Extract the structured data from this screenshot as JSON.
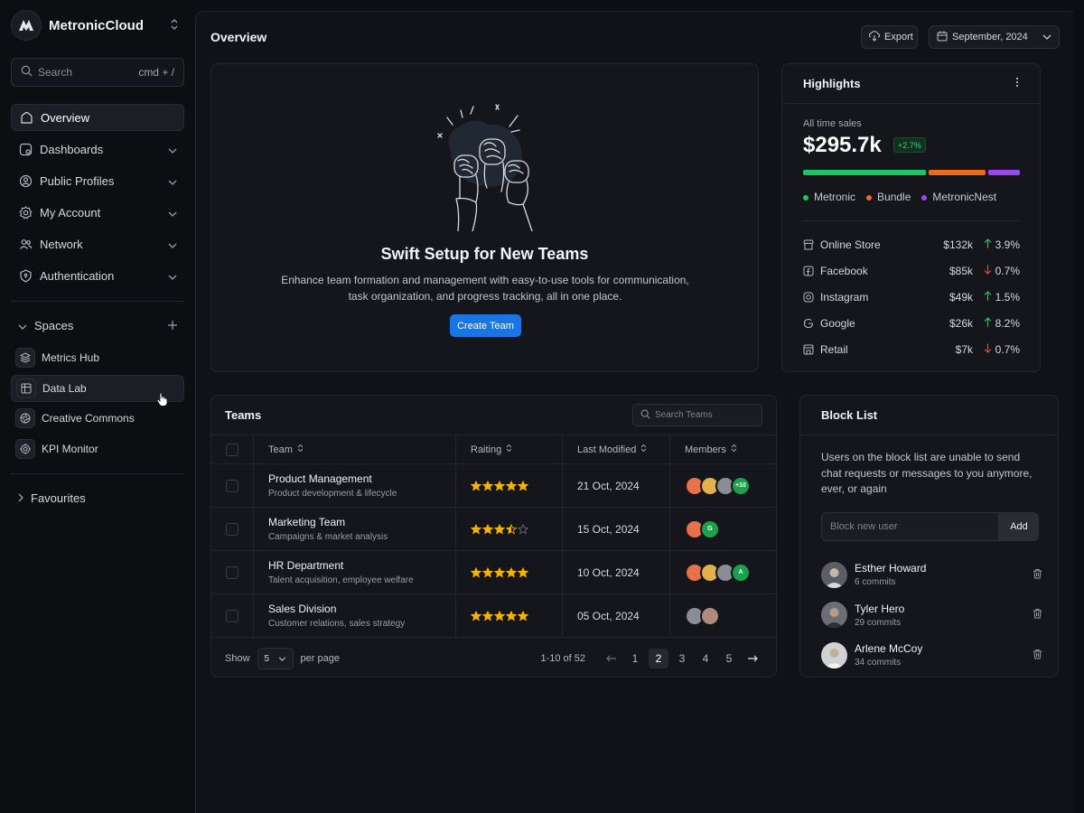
{
  "brand": {
    "name": "MetronicCloud"
  },
  "search": {
    "placeholder": "Search",
    "shortcut": "cmd + /"
  },
  "nav": [
    {
      "label": "Overview",
      "icon": "home-icon"
    },
    {
      "label": "Dashboards",
      "icon": "dashboard-icon"
    },
    {
      "label": "Public Profiles",
      "icon": "profile-icon"
    },
    {
      "label": "My Account",
      "icon": "gear-icon"
    },
    {
      "label": "Network",
      "icon": "users-icon"
    },
    {
      "label": "Authentication",
      "icon": "shield-icon"
    }
  ],
  "spaces": {
    "title": "Spaces",
    "items": [
      {
        "label": "Metrics Hub"
      },
      {
        "label": "Data Lab"
      },
      {
        "label": "Creative Commons"
      },
      {
        "label": "KPI Monitor"
      }
    ]
  },
  "favourites": {
    "title": "Favourites"
  },
  "header": {
    "title": "Overview",
    "export_label": "Export",
    "date_label": "September, 2024"
  },
  "hero": {
    "title": "Swift Setup for New Teams",
    "description": "Enhance team formation and management with easy-to-use tools for communication, task organization, and progress tracking, all in one place.",
    "button_label": "Create Team"
  },
  "highlights": {
    "title": "Highlights",
    "subtitle": "All time sales",
    "value": "$295.7k",
    "badge": "+2.7%",
    "segments": [
      {
        "name": "Metronic",
        "color": "#17c964",
        "share": 0.58
      },
      {
        "name": "Bundle",
        "color": "#f06a1b",
        "share": 0.27
      },
      {
        "name": "MetronicNest",
        "color": "#9b47f5",
        "share": 0.15
      }
    ],
    "rows": [
      {
        "name": "Online Store",
        "amount": "$132k",
        "change": "3.9%",
        "direction": "up"
      },
      {
        "name": "Facebook",
        "amount": "$85k",
        "change": "0.7%",
        "direction": "down"
      },
      {
        "name": "Instagram",
        "amount": "$49k",
        "change": "1.5%",
        "direction": "up"
      },
      {
        "name": "Google",
        "amount": "$26k",
        "change": "8.2%",
        "direction": "up"
      },
      {
        "name": "Retail",
        "amount": "$7k",
        "change": "0.7%",
        "direction": "down"
      }
    ]
  },
  "teams": {
    "title": "Teams",
    "search_placeholder": "Search Teams",
    "columns": {
      "team": "Team",
      "rating": "Raiting",
      "modified": "Last Modified",
      "members": "Members"
    },
    "rows": [
      {
        "name": "Product Management",
        "desc": "Product development & lifecycle",
        "rating": 5,
        "date": "21 Oct, 2024",
        "extra": "+10"
      },
      {
        "name": "Marketing Team",
        "desc": "Campaigns & market analysis",
        "rating": 3.5,
        "date": "15 Oct, 2024",
        "extra": "G"
      },
      {
        "name": "HR Department",
        "desc": "Talent acquisition, employee welfare",
        "rating": 5,
        "date": "10 Oct, 2024",
        "extra": "A"
      },
      {
        "name": "Sales Division",
        "desc": "Customer relations, sales strategy",
        "rating": 5,
        "date": "05 Oct, 2024",
        "extra": ""
      }
    ],
    "footer": {
      "show": "Show",
      "per_page_value": "5",
      "per_page": "per page",
      "range": "1-10 of 52",
      "pages": [
        "1",
        "2",
        "3",
        "4",
        "5"
      ],
      "current_page": "2"
    }
  },
  "blocklist": {
    "title": "Block List",
    "description": "Users on the block list are unable to send chat requests or messages to you anymore, ever, or again",
    "input_placeholder": "Block new user",
    "add_label": "Add",
    "users": [
      {
        "name": "Esther Howard",
        "commits": "6 commits"
      },
      {
        "name": "Tyler Hero",
        "commits": "29 commits"
      },
      {
        "name": "Arlene McCoy",
        "commits": "34 commits"
      }
    ]
  },
  "colors": {
    "accent": "#1b74e4",
    "up": "#17c964",
    "down": "#f04438",
    "star": "#f5b301"
  }
}
